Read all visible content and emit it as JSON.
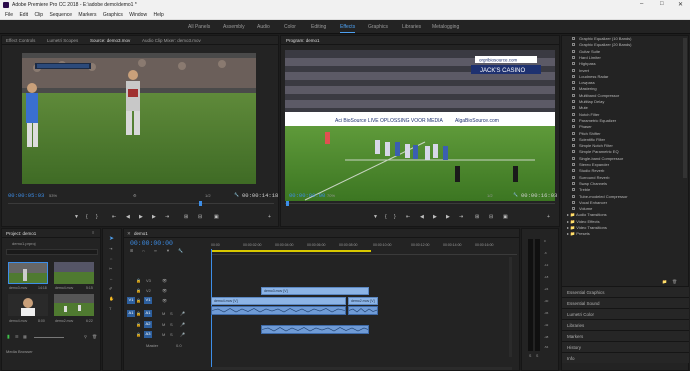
{
  "window": {
    "title": "Adobe Premiere Pro CC 2018 - E:\\adobe demo\\demo1 *"
  },
  "menu": [
    "File",
    "Edit",
    "Clip",
    "Sequence",
    "Markers",
    "Graphics",
    "Window",
    "Help"
  ],
  "workspaces": [
    {
      "label": "All Panels",
      "active": false
    },
    {
      "label": "Assembly",
      "active": false
    },
    {
      "label": "Audio",
      "active": false
    },
    {
      "label": "Color",
      "active": false
    },
    {
      "label": "Editing",
      "active": false
    },
    {
      "label": "Effects",
      "active": true
    },
    {
      "label": "Graphics",
      "active": false
    },
    {
      "label": "Libraries",
      "active": false
    },
    {
      "label": "Metalogging",
      "active": false
    }
  ],
  "source_panel": {
    "tabs": [
      "Effect Controls",
      "Lumetri Scopes",
      "Source: demo3.mov",
      "Audio Clip Mixer: demo3.mov"
    ],
    "timecode_in": "00:00:05:03",
    "zoom": "53%",
    "resolution": "1/2",
    "duration": "00:00:14:18"
  },
  "program_panel": {
    "tabs": [
      "Program: demo1"
    ],
    "timecode_in": "00:00:00:00",
    "zoom": "70%",
    "resolution": "1/2",
    "duration": "00:00:16:03",
    "banners": [
      "JACK'S CASINO",
      "orgribiosource.com",
      "Aci BioSource LIVE OPLOSSING VOOR MEDIA",
      "AlgaBioSource.com"
    ]
  },
  "project_panel": {
    "title": "Project: demo1",
    "file": "demo1.prproj",
    "thumbs": [
      {
        "label": "demo3.mov",
        "duration": "14:18"
      },
      {
        "label": "demo4.mov",
        "duration": "5:15"
      },
      {
        "label": "demo4.mov",
        "duration": "8:00"
      },
      {
        "label": "demo2.mov",
        "duration": "6:22"
      }
    ],
    "media_browser": "Media Browser"
  },
  "timeline": {
    "tab": "demo1",
    "timecode": "00:00:00:00",
    "ruler": [
      "00:00",
      "00:00:02:00",
      "00:00:04:00",
      "00:00:06:00",
      "00:00:08:00",
      "00:00:10:00",
      "00:00:12:00",
      "00:00:14:00",
      "00:00:16:00"
    ],
    "video_tracks": [
      "V3",
      "V2",
      "V1"
    ],
    "audio_tracks": [
      "A1",
      "A2",
      "A3"
    ],
    "master": "Master",
    "master_value": "0.0",
    "clips": {
      "v2": "demo3.mov [V]",
      "v1a": "demo4.mov [V]",
      "v1b": "demo2.mov [V]"
    }
  },
  "audio_meters": {
    "scale": [
      "0",
      "-6",
      "-12",
      "-18",
      "-24",
      "-30",
      "-36",
      "-42",
      "-48",
      "-54"
    ],
    "labels": [
      "S",
      "S"
    ]
  },
  "effects_panel": {
    "items": [
      "Graphic Equalizer (10 Bands)",
      "Graphic Equalizer (20 Bands)",
      "Guitar Suite",
      "Hard Limiter",
      "Highpass",
      "Invert",
      "Loudness Radar",
      "Lowpass",
      "Mastering",
      "Multiband Compressor",
      "Multitap Delay",
      "Mute",
      "Notch Filter",
      "Parametric Equalizer",
      "Phaser",
      "Pitch Shifter",
      "Scientific Filter",
      "Simple Notch Filter",
      "Simple Parametric EQ",
      "Single-band Compressor",
      "Stereo Expander",
      "Studio Reverb",
      "Surround Reverb",
      "Swap Channels",
      "Treble",
      "Tube-modeled Compressor",
      "Vocal Enhancer",
      "Volume"
    ],
    "folders": [
      "Audio Transitions",
      "Video Effects",
      "Video Transitions",
      "Presets"
    ],
    "sections": [
      "Essential Graphics",
      "Essential Sound",
      "Lumetri Color",
      "Libraries",
      "Markers",
      "History",
      "Info"
    ]
  }
}
